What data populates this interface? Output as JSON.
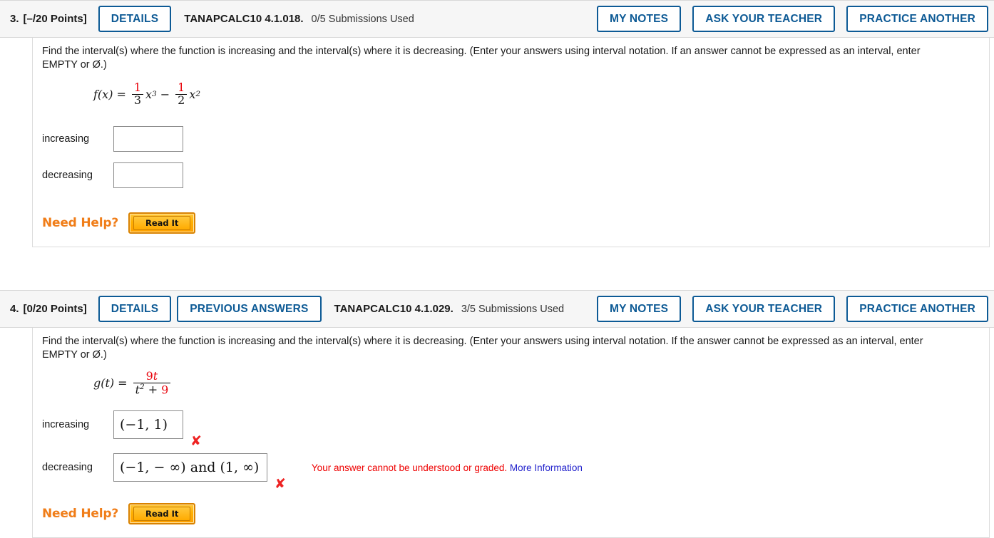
{
  "problems": [
    {
      "number": "3.",
      "points": "[–/20 Points]",
      "details_label": "DETAILS",
      "previous_answers_label": null,
      "code": "TANAPCALC10 4.1.018.",
      "submissions": "0/5 Submissions Used",
      "my_notes_label": "MY NOTES",
      "ask_teacher_label": "ASK YOUR TEACHER",
      "practice_another_label": "PRACTICE ANOTHER",
      "question_line1": "Find the interval(s) where the function is increasing and the interval(s) where it is decreasing. (Enter your answers using interval notation. If an answer cannot be expressed as an interval, enter",
      "question_line2": "EMPTY or Ø.)",
      "formula": {
        "lhs": "f(x)",
        "equals": "=",
        "term1_num": "1",
        "term1_den": "3",
        "term1_var": "x",
        "term1_exp": "3",
        "operator": "−",
        "term2_num": "1",
        "term2_den": "2",
        "term2_var": "x",
        "term2_exp": "2"
      },
      "increasing_label": "increasing",
      "increasing_value": "",
      "increasing_mark": null,
      "decreasing_label": "decreasing",
      "decreasing_value": "",
      "decreasing_mark": null,
      "error_message": null,
      "error_link": null,
      "need_help_label": "Need Help?",
      "read_it_label": "Read It"
    },
    {
      "number": "4.",
      "points": "[0/20 Points]",
      "details_label": "DETAILS",
      "previous_answers_label": "PREVIOUS ANSWERS",
      "code": "TANAPCALC10 4.1.029.",
      "submissions": "3/5 Submissions Used",
      "my_notes_label": "MY NOTES",
      "ask_teacher_label": "ASK YOUR TEACHER",
      "practice_another_label": "PRACTICE ANOTHER",
      "question_line1": "Find the interval(s) where the function is increasing and the interval(s) where it is decreasing. (Enter your answers using interval notation. If the answer cannot be expressed as an interval, enter",
      "question_line2": "EMPTY or Ø.)",
      "formula": {
        "lhs": "g(t)",
        "equals": "=",
        "num_coeff": "9",
        "num_var": "t",
        "den_var": "t",
        "den_exp": "2",
        "den_op": "+",
        "den_const": "9"
      },
      "increasing_label": "increasing",
      "increasing_value": "(−1, 1)",
      "increasing_mark": "✘",
      "decreasing_label": "decreasing",
      "decreasing_value": "(−1, − ∞) and (1, ∞)",
      "decreasing_mark": "✘",
      "error_message": "Your answer cannot be understood or graded.",
      "error_link": "More Information",
      "need_help_label": "Need Help?",
      "read_it_label": "Read It"
    }
  ],
  "colors": {
    "accent_blue": "#0d5a95",
    "error_red": "#ee0000",
    "math_red": "#e8030b",
    "orange": "#f07d18",
    "link_blue": "#2222cc"
  }
}
